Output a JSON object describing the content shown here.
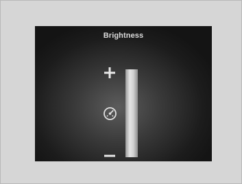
{
  "screen": {
    "title": "Brightness"
  },
  "icons": {
    "increase": "plus-icon",
    "mode": "gauge-icon",
    "decrease": "minus-icon"
  },
  "brightness": {
    "level_fraction": 1.0
  },
  "colors": {
    "frame": "#d6d6d6",
    "screen": "#1c1c1c",
    "text": "#dcdcdc",
    "fill": "#d0d0d0"
  }
}
